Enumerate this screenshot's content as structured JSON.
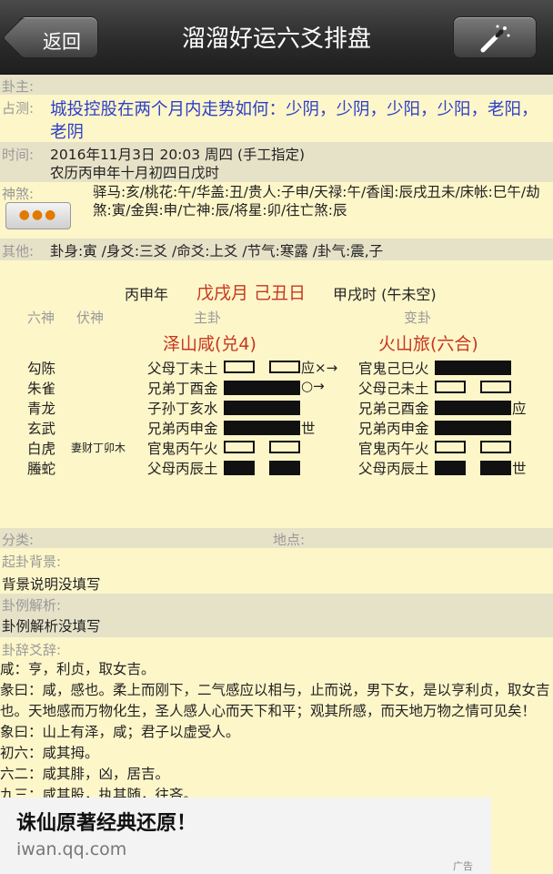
{
  "header": {
    "back_label": "返回",
    "title": "溜溜好运六爻排盘"
  },
  "info": {
    "gua_zhu_label": "卦主:",
    "zhan_ce_label": "占测:",
    "question": "城投控股在两个月内走势如何：少阴，少阴，少阳，少阳，老阳，老阴",
    "time_label": "时间:",
    "time_value": "2016年11月3日 20:03 周四 (手工指定)",
    "lunar_value": "农历丙申年十月初四日戊时",
    "shensha_label": "神煞:",
    "shensha_value": "驿马:亥/桃花:午/华盖:丑/贵人:子申/天禄:午/香闺:辰戌丑未/床帐:巳午/劫煞:寅/金舆:申/亡神:辰/将星:卯/往亡煞:辰",
    "more_btn": "●●●",
    "other_label": "其他:",
    "other_value": "卦身:寅 /身爻:三爻 /命爻:上爻 /节气:寒露 /卦气:震,子"
  },
  "pan": {
    "year": "丙申年",
    "month_day": "戊戌月 己丑日",
    "hour": "甲戌时 (午未空)",
    "col_liushen": "六神",
    "col_fushen": "伏神",
    "col_main": "主卦",
    "col_change": "变卦",
    "main_name": "泽山咸(兑4)",
    "change_name": "火山旅(六合)",
    "rows": [
      {
        "shen": "勾陈",
        "fu": "",
        "main": "父母丁未土",
        "mark": "应×→",
        "change": "官鬼己巳火",
        "change_mark": ""
      },
      {
        "shen": "朱雀",
        "fu": "",
        "main": "兄弟丁酉金",
        "mark": "○→",
        "change": "父母己未土",
        "change_mark": ""
      },
      {
        "shen": "青龙",
        "fu": "",
        "main": "子孙丁亥水",
        "mark": "",
        "change": "兄弟己酉金",
        "change_mark": "应"
      },
      {
        "shen": "玄武",
        "fu": "",
        "main": "兄弟丙申金",
        "mark": "世",
        "change": "兄弟丙申金",
        "change_mark": ""
      },
      {
        "shen": "白虎",
        "fu": "妻财丁卯木",
        "main": "官鬼丙午火",
        "mark": "",
        "change": "官鬼丙午火",
        "change_mark": ""
      },
      {
        "shen": "螣蛇",
        "fu": "",
        "main": "父母丙辰土",
        "mark": "",
        "change": "父母丙辰土",
        "change_mark": "世"
      }
    ]
  },
  "bottom": {
    "fenlei_label": "分类:",
    "didian_label": "地点:",
    "beijing_label": "起卦背景:",
    "beijing_value": "背景说明没填写",
    "jiexi_label": "卦例解析:",
    "jiexi_value": "卦例解析没填写",
    "guaci_label": "卦辞爻辞:",
    "lines": [
      "咸：亨，利贞，取女吉。",
      "彖曰：咸，感也。柔上而刚下，二气感应以相与，止而说，男下女，是以亨利贞，取女吉也。天地感而万物化生，圣人感人心而天下和平；观其所感，而天地万物之情可见矣！",
      "象曰：山上有泽，咸；君子以虚受人。",
      "初六：咸其拇。",
      "六二：咸其腓，凶，居吉。",
      "九三：咸其股，执其随，往吝。"
    ]
  },
  "ad": {
    "title": "诛仙原著经典还原！",
    "url": "iwan.qq.com",
    "tag": "广告"
  }
}
